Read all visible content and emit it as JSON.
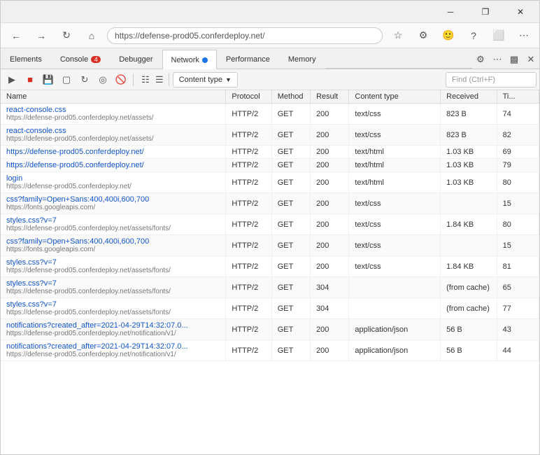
{
  "window": {
    "title_btn_minimize": "─",
    "title_btn_restore": "❐",
    "title_btn_close": "✕"
  },
  "browser": {
    "toolbar_icons": [
      "←",
      "→",
      "↻",
      "⌂"
    ]
  },
  "devtools": {
    "tabs": [
      {
        "label": "Elements",
        "active": false,
        "badge": null
      },
      {
        "label": "Console",
        "active": false,
        "badge": "4"
      },
      {
        "label": "Debugger",
        "active": false,
        "badge": null
      },
      {
        "label": "Network",
        "active": true,
        "badge": null,
        "dot": true
      },
      {
        "label": "Performance",
        "active": false,
        "badge": null
      },
      {
        "label": "Memory",
        "active": false,
        "badge": null
      }
    ],
    "toolbar": {
      "buttons": [
        "▶",
        "⏹",
        "💾",
        "⬛",
        "🔃",
        "⟳",
        "⊘",
        "≡",
        "🚫"
      ],
      "filter_icon": "⚙",
      "content_type_label": "Content type",
      "search_placeholder": "Find (Ctrl+F)"
    }
  },
  "table": {
    "columns": [
      "Name",
      "Protocol",
      "Method",
      "Result",
      "Content type",
      "Received",
      "Ti..."
    ],
    "rows": [
      {
        "name": "react-console.css",
        "url": "https://defense-prod05.conferdeploy.net/assets/",
        "protocol": "HTTP/2",
        "method": "GET",
        "result": "200",
        "content_type": "text/css",
        "received": "823 B",
        "time": "74"
      },
      {
        "name": "react-console.css",
        "url": "https://defense-prod05.conferdeploy.net/assets/",
        "protocol": "HTTP/2",
        "method": "GET",
        "result": "200",
        "content_type": "text/css",
        "received": "823 B",
        "time": "82"
      },
      {
        "name": "https://defense-prod05.conferdeploy.net/",
        "url": "",
        "protocol": "HTTP/2",
        "method": "GET",
        "result": "200",
        "content_type": "text/html",
        "received": "1.03 KB",
        "time": "69"
      },
      {
        "name": "https://defense-prod05.conferdeploy.net/",
        "url": "",
        "protocol": "HTTP/2",
        "method": "GET",
        "result": "200",
        "content_type": "text/html",
        "received": "1.03 KB",
        "time": "79"
      },
      {
        "name": "login",
        "url": "https://defense-prod05.conferdeploy.net/",
        "protocol": "HTTP/2",
        "method": "GET",
        "result": "200",
        "content_type": "text/html",
        "received": "1.03 KB",
        "time": "80"
      },
      {
        "name": "css?family=Open+Sans:400,400i,600,700",
        "url": "https://fonts.googleapis.com/",
        "protocol": "HTTP/2",
        "method": "GET",
        "result": "200",
        "content_type": "text/css",
        "received": "",
        "time": "15"
      },
      {
        "name": "styles.css?v=7",
        "url": "https://defense-prod05.conferdeploy.net/assets/fonts/",
        "protocol": "HTTP/2",
        "method": "GET",
        "result": "200",
        "content_type": "text/css",
        "received": "1.84 KB",
        "time": "80"
      },
      {
        "name": "css?family=Open+Sans:400,400i,600,700",
        "url": "https://fonts.googleapis.com/",
        "protocol": "HTTP/2",
        "method": "GET",
        "result": "200",
        "content_type": "text/css",
        "received": "",
        "time": "15"
      },
      {
        "name": "styles.css?v=7",
        "url": "https://defense-prod05.conferdeploy.net/assets/fonts/",
        "protocol": "HTTP/2",
        "method": "GET",
        "result": "200",
        "content_type": "text/css",
        "received": "1.84 KB",
        "time": "81"
      },
      {
        "name": "styles.css?v=7",
        "url": "https://defense-prod05.conferdeploy.net/assets/fonts/",
        "protocol": "HTTP/2",
        "method": "GET",
        "result": "304",
        "content_type": "",
        "received": "(from cache)",
        "time": "65"
      },
      {
        "name": "styles.css?v=7",
        "url": "https://defense-prod05.conferdeploy.net/assets/fonts/",
        "protocol": "HTTP/2",
        "method": "GET",
        "result": "304",
        "content_type": "",
        "received": "(from cache)",
        "time": "77"
      },
      {
        "name": "notifications?created_after=2021-04-29T14:32:07.0...",
        "url": "https://defense-prod05.conferdeploy.net/notification/v1/",
        "protocol": "HTTP/2",
        "method": "GET",
        "result": "200",
        "content_type": "application/json",
        "received": "56 B",
        "time": "43"
      },
      {
        "name": "notifications?created_after=2021-04-29T14:32:07.0...",
        "url": "https://defense-prod05.conferdeploy.net/notification/v1/",
        "protocol": "HTTP/2",
        "method": "GET",
        "result": "200",
        "content_type": "application/json",
        "received": "56 B",
        "time": "44"
      }
    ]
  }
}
